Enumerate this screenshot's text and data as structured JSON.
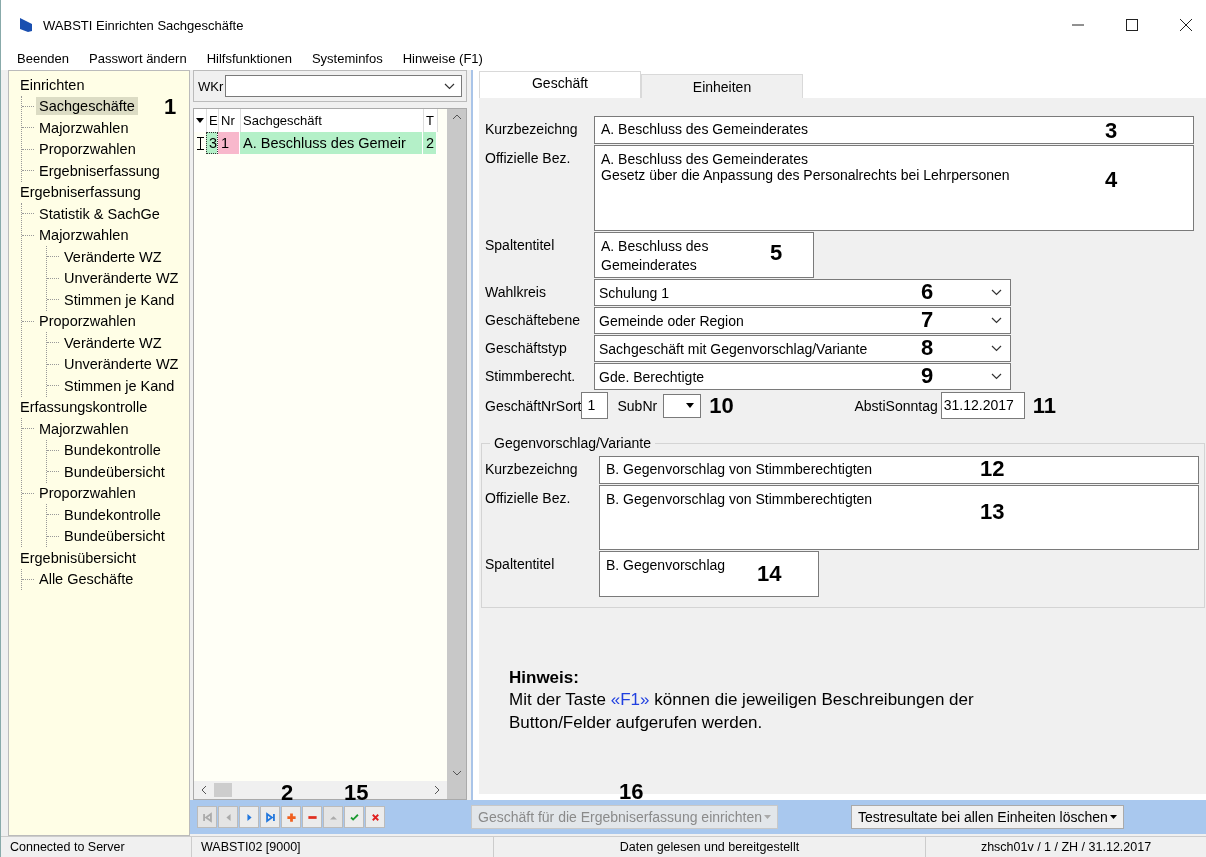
{
  "window": {
    "title": "WABSTI Einrichten Sachgeschäfte"
  },
  "menu": [
    "Beenden",
    "Passwort ändern",
    "Hilfsfunktionen",
    "Systeminfos",
    "Hinweise (F1)"
  ],
  "tree": [
    {
      "label": "Einrichten",
      "selected": false,
      "children": [
        {
          "label": "Sachgeschäfte",
          "selected": true,
          "callout": "1"
        },
        {
          "label": "Majorzwahlen",
          "selected": false
        },
        {
          "label": "Proporzwahlen",
          "selected": false
        },
        {
          "label": "Ergebniserfassung",
          "selected": false
        }
      ]
    },
    {
      "label": "Ergebniserfassung",
      "selected": false,
      "children": [
        {
          "label": "Statistik & SachGe",
          "selected": false
        },
        {
          "label": "Majorzwahlen",
          "selected": false,
          "children": [
            {
              "label": "Veränderte WZ",
              "selected": false
            },
            {
              "label": "Unveränderte WZ",
              "selected": false
            },
            {
              "label": "Stimmen je Kand",
              "selected": false
            }
          ]
        },
        {
          "label": "Proporzwahlen",
          "selected": false,
          "children": [
            {
              "label": "Veränderte WZ",
              "selected": false
            },
            {
              "label": "Unveränderte WZ",
              "selected": false
            },
            {
              "label": "Stimmen je Kand",
              "selected": false
            }
          ]
        }
      ]
    },
    {
      "label": "Erfassungskontrolle",
      "selected": false,
      "children": [
        {
          "label": "Majorzwahlen",
          "selected": false,
          "children": [
            {
              "label": "Bundekontrolle",
              "selected": false
            },
            {
              "label": "Bundeübersicht",
              "selected": false
            }
          ]
        },
        {
          "label": "Proporzwahlen",
          "selected": false,
          "children": [
            {
              "label": "Bundekontrolle",
              "selected": false
            },
            {
              "label": "Bundeübersicht",
              "selected": false
            }
          ]
        }
      ]
    },
    {
      "label": "Ergebnisübersicht",
      "selected": false,
      "children": [
        {
          "label": "Alle Geschäfte",
          "selected": false
        }
      ]
    }
  ],
  "filter": {
    "label": "WKr"
  },
  "grid": {
    "columns": [
      "E",
      "Nr",
      "Sachgeschäft",
      "T"
    ],
    "rows": [
      {
        "cells": [
          {
            "text": "3",
            "color": "#b4f0c8",
            "focused": true
          },
          {
            "text": "1",
            "color": "#f8b8cc",
            "focused": false
          },
          {
            "text": "A. Beschluss des Gemeir",
            "color": "#b4f0c8",
            "focused": false
          },
          {
            "text": "2",
            "color": "#b4f0c8",
            "focused": false
          }
        ]
      }
    ]
  },
  "tabs": [
    {
      "label": "Geschäft",
      "selected": true
    },
    {
      "label": "Einheiten",
      "selected": false
    }
  ],
  "fields": [
    {
      "kind": "text",
      "label": "Kurzbezeichng",
      "value": "A. Beschluss des Gemeinderates",
      "callout": "3"
    },
    {
      "kind": "memo",
      "label": "Offizielle Bez.",
      "value": "A. Beschluss des Gemeinderates\nGesetz über die Anpassung des Personalrechts bei Lehrpersonen",
      "callout": "4"
    },
    {
      "kind": "title",
      "label": "Spaltentitel",
      "value": "A. Beschluss des\nGemeinderates",
      "callout": "5"
    },
    {
      "kind": "combo",
      "label": "Wahlkreis",
      "value": "Schulung 1",
      "callout": "6"
    },
    {
      "kind": "combo",
      "label": "Geschäftebene",
      "value": "Gemeinde oder Region",
      "callout": "7"
    },
    {
      "kind": "combo",
      "label": "Geschäftstyp",
      "value": "Sachgeschäft mit Gegenvorschlag/Variante",
      "callout": "8"
    },
    {
      "kind": "combo",
      "label": "Stimmberecht.",
      "value": "Gde. Berechtigte",
      "callout": "9"
    }
  ],
  "numbers": {
    "sort_label": "GeschäftNrSort",
    "sort_value": "1",
    "sub_label": "SubNr",
    "sub_callout": "10",
    "date_label": "AbstiSonntag",
    "date_value": "31.12.2017",
    "date_callout": "11"
  },
  "group": {
    "title": "Gegenvorschlag/Variante",
    "fields": [
      {
        "kind": "text",
        "label": "Kurzbezeichng",
        "value": "B. Gegenvorschlag von Stimmberechtigten",
        "callout": "12"
      },
      {
        "kind": "memo",
        "label": "Offizielle Bez.",
        "value": "B. Gegenvorschlag von Stimmberechtigten",
        "callout": "13"
      },
      {
        "kind": "title",
        "label": "Spaltentitel",
        "value": "B. Gegenvorschlag",
        "callout": "14"
      }
    ]
  },
  "hint": {
    "title": "Hinweis:",
    "before": "Mit der Taste",
    "key": "«F1»",
    "after": "können die jeweiligen Beschreibungen der Button/Felder aufgerufen werden."
  },
  "navigator": [
    {
      "kind": "first",
      "disabled": true
    },
    {
      "kind": "prev",
      "disabled": true
    },
    {
      "kind": "next",
      "disabled": false
    },
    {
      "kind": "last",
      "disabled": false
    },
    {
      "kind": "add",
      "disabled": false,
      "callout": "2"
    },
    {
      "kind": "remove",
      "disabled": false
    },
    {
      "kind": "up",
      "disabled": true
    },
    {
      "kind": "confirm",
      "disabled": false,
      "callout": "15"
    },
    {
      "kind": "cancel",
      "disabled": false
    }
  ],
  "actions": [
    {
      "label": "Geschäft für die Ergebniserfassung einrichten",
      "disabled": true,
      "callout": "16"
    },
    {
      "label": "Testresultate bei allen Einheiten löschen",
      "disabled": false
    }
  ],
  "status_bar": [
    "Connected to Server",
    "WABSTI02 [9000]",
    "Daten gelesen und bereitgestellt",
    "zhsch01v / 1 / ZH / 31.12.2017"
  ]
}
